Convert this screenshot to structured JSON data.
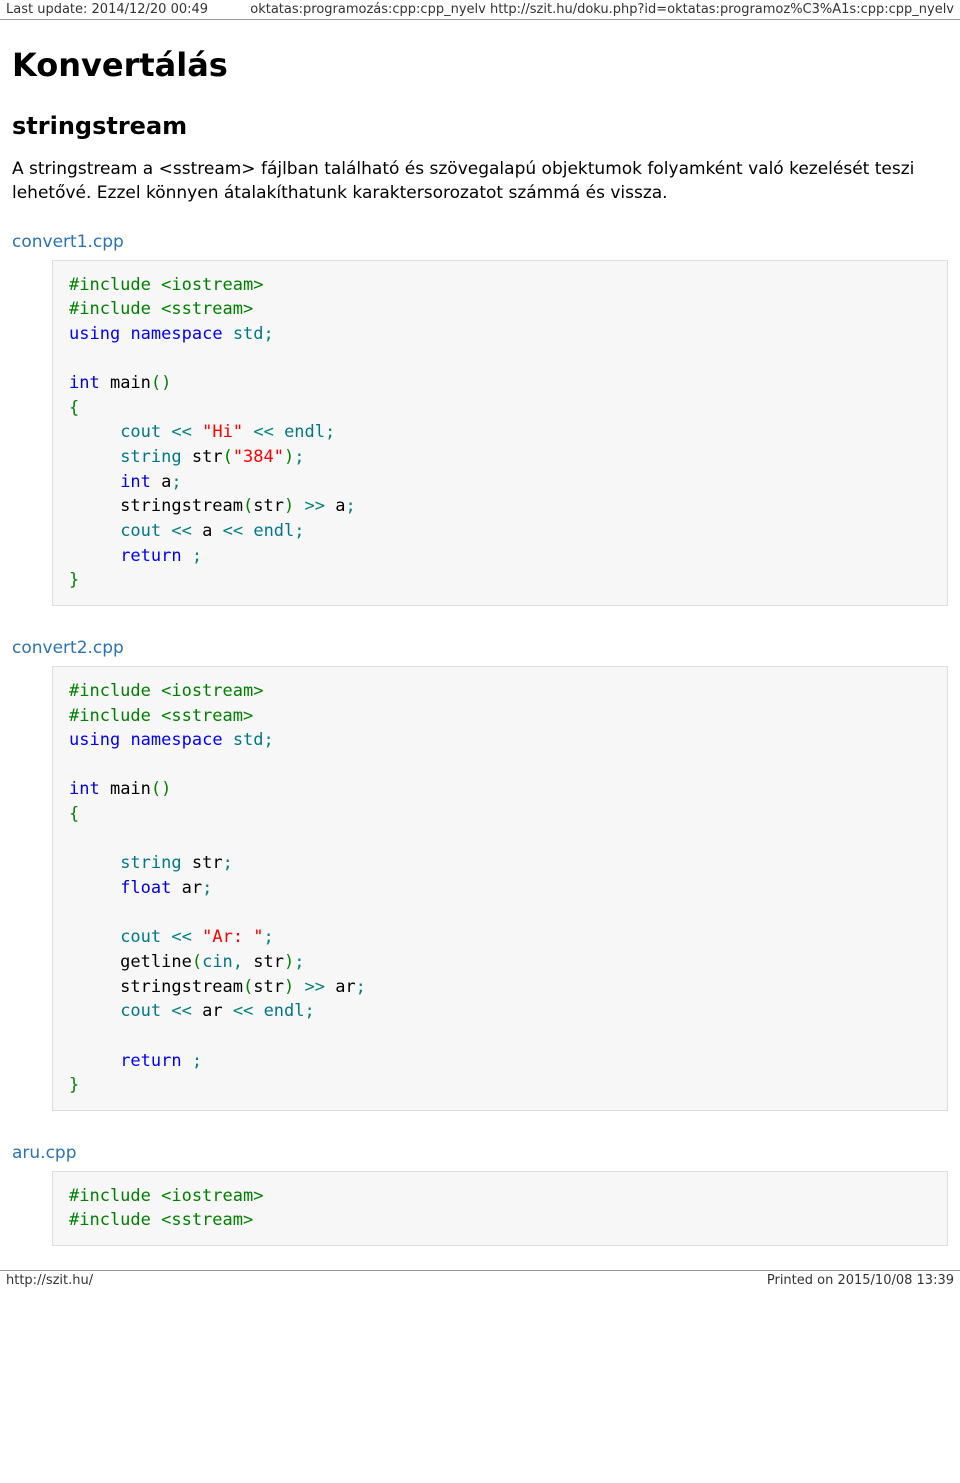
{
  "topbar": {
    "left": "Last update: 2014/12/20 00:49",
    "right": "oktatas:programozás:cpp:cpp_nyelv http://szit.hu/doku.php?id=oktatas:programoz%C3%A1s:cpp:cpp_nyelv"
  },
  "heading1": "Konvertálás",
  "heading2": "stringstream",
  "intro": "A stringstream a <sstream> fájlban található és szövegalapú objektumok folyamként való kezelését teszi lehetővé. Ezzel könnyen átalakíthatunk karaktersorozatot számmá és vissza.",
  "files": {
    "f1": "convert1.cpp",
    "f2": "convert2.cpp",
    "f3": "aru.cpp"
  },
  "code1": {
    "inc1a": "#include <iostream>",
    "inc1b": "#include <sstream>",
    "using": "using",
    "namespace": "namespace",
    "std": "std",
    "int": "int",
    "main": "main",
    "cout": "cout",
    "hi": "\"Hi\"",
    "endl": "endl",
    "string": "string",
    "str": "str",
    "s384": "\"384\"",
    "a": "a",
    "stringstream": "stringstream",
    "return": "return"
  },
  "code2": {
    "inc1a": "#include <iostream>",
    "inc1b": "#include <sstream>",
    "using": "using",
    "namespace": "namespace",
    "std": "std",
    "int": "int",
    "main": "main",
    "string": "string",
    "str": "str",
    "float": "float",
    "ar": "ar",
    "cout": "cout",
    "arlabel": "\"Ar: \"",
    "getline": "getline",
    "cin": "cin",
    "stringstream": "stringstream",
    "endl": "endl",
    "return": "return"
  },
  "code3": {
    "inc1a": "#include <iostream>",
    "inc1b": "#include <sstream>"
  },
  "footer": {
    "left": "http://szit.hu/",
    "right": "Printed on 2015/10/08 13:39"
  }
}
